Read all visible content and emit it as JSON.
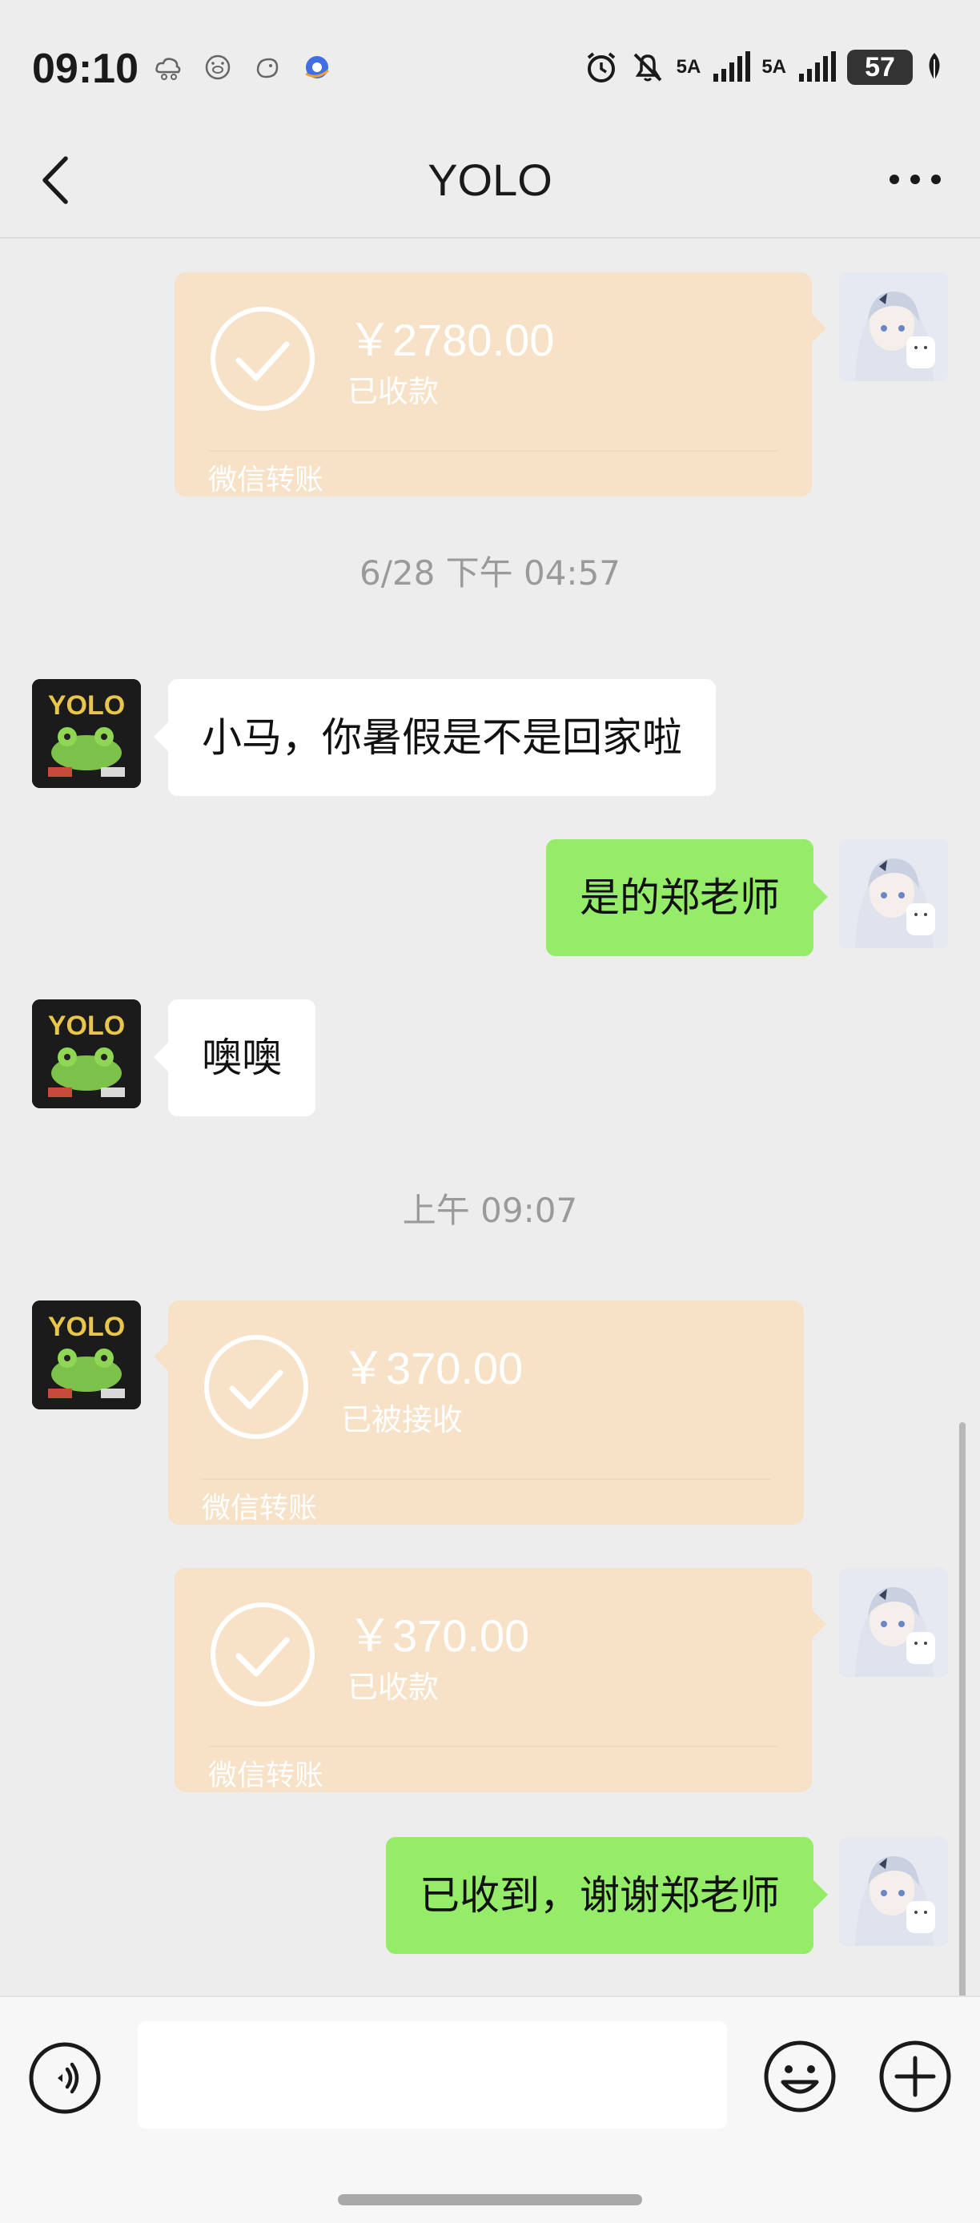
{
  "status_bar": {
    "time": "09:10",
    "signal_1": "5A",
    "signal_2": "5A",
    "battery": "57",
    "notification_icons": [
      "cloud-app-icon",
      "pig-app-icon",
      "bird-app-icon",
      "blue-app-icon"
    ],
    "system_icons": [
      "alarm-icon",
      "mute-bell-icon",
      "signal-icon",
      "signal-icon",
      "battery-icon",
      "leaf-icon"
    ]
  },
  "header": {
    "title": "YOLO",
    "back_icon": "chevron-left-icon",
    "more_icon": "more-dots-icon"
  },
  "messages": {
    "transfer_1": {
      "amount": "￥2780.00",
      "status": "已收款",
      "source": "微信转账"
    },
    "timestamp_1": "6/28 下午 04:57",
    "text_1": "小马，你暑假是不是回家啦",
    "text_2": "是的郑老师",
    "text_3": "噢噢",
    "timestamp_2": "上午 09:07",
    "transfer_2": {
      "amount": "￥370.00",
      "status": "已被接收",
      "source": "微信转账"
    },
    "transfer_3": {
      "amount": "￥370.00",
      "status": "已收款",
      "source": "微信转账"
    },
    "text_4": "已收到，谢谢郑老师"
  },
  "input_bar": {
    "voice_icon": "voice-icon",
    "emoji_icon": "emoji-icon",
    "plus_icon": "plus-icon",
    "input_value": ""
  },
  "colors": {
    "background": "#ededed",
    "outgoing_bubble": "#95ec69",
    "incoming_bubble": "#ffffff",
    "transfer_card": "#f7e2c7"
  }
}
